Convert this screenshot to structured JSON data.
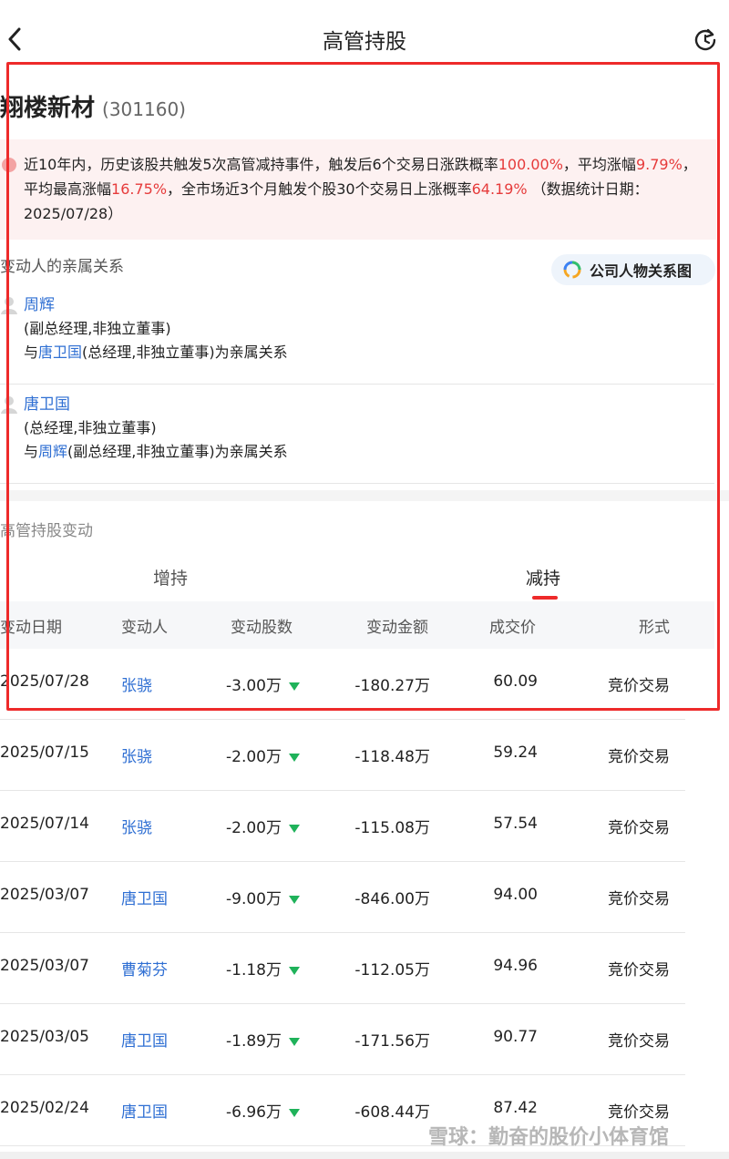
{
  "header": {
    "title": "高管持股"
  },
  "stock": {
    "name": "翔楼新材",
    "code": "(301160)"
  },
  "alert": {
    "p1": "近10年内，历史该股共触发5次高管减持事件，触发后6个交易日涨跌概率",
    "v1": "100.00%",
    "p2": "，平均涨幅",
    "v2": "9.79%",
    "p3": "，平均最高涨幅",
    "v3": "16.75%",
    "p4": "，全市场近3个月触发个股30个交易日上涨概率",
    "v4": "64.19%",
    "p5": " （数据统计日期：2025/07/28）"
  },
  "relations": {
    "title": "变动人的亲属关系",
    "graph_button": "公司人物关系图",
    "people": [
      {
        "name": "周辉",
        "role": "(副总经理,非独立董事)",
        "rel_prefix": "与",
        "rel_name": "唐卫国",
        "rel_suffix": "(总经理,非独立董事)为亲属关系"
      },
      {
        "name": "唐卫国",
        "role": "(总经理,非独立董事)",
        "rel_prefix": "与",
        "rel_name": "周辉",
        "rel_suffix": "(副总经理,非独立董事)为亲属关系"
      }
    ]
  },
  "changes": {
    "title": "高管持股变动",
    "tabs": [
      "增持",
      "减持"
    ],
    "active_tab": "减持",
    "columns": [
      "变动日期",
      "变动人",
      "变动股数",
      "变动金额",
      "成交价",
      "形式"
    ],
    "rows": [
      {
        "date": "2025/07/28",
        "person": "张骁",
        "shares": "-3.00万",
        "amount": "-180.27万",
        "price": "60.09",
        "type": "竞价交易"
      },
      {
        "date": "2025/07/15",
        "person": "张骁",
        "shares": "-2.00万",
        "amount": "-118.48万",
        "price": "59.24",
        "type": "竞价交易"
      },
      {
        "date": "2025/07/14",
        "person": "张骁",
        "shares": "-2.00万",
        "amount": "-115.08万",
        "price": "57.54",
        "type": "竞价交易"
      },
      {
        "date": "2025/03/07",
        "person": "唐卫国",
        "shares": "-9.00万",
        "amount": "-846.00万",
        "price": "94.00",
        "type": "竞价交易"
      },
      {
        "date": "2025/03/07",
        "person": "曹菊芬",
        "shares": "-1.18万",
        "amount": "-112.05万",
        "price": "94.96",
        "type": "竞价交易"
      },
      {
        "date": "2025/03/05",
        "person": "唐卫国",
        "shares": "-1.89万",
        "amount": "-171.56万",
        "price": "90.77",
        "type": "竞价交易"
      },
      {
        "date": "2025/02/24",
        "person": "唐卫国",
        "shares": "-6.96万",
        "amount": "-608.44万",
        "price": "87.42",
        "type": "竞价交易"
      }
    ]
  },
  "watermark": "雪球：勤奋的股价小体育馆",
  "colors": {
    "accent_red": "#ee2a2a",
    "link_blue": "#2f6fd3",
    "down_green": "#1fb25a"
  }
}
